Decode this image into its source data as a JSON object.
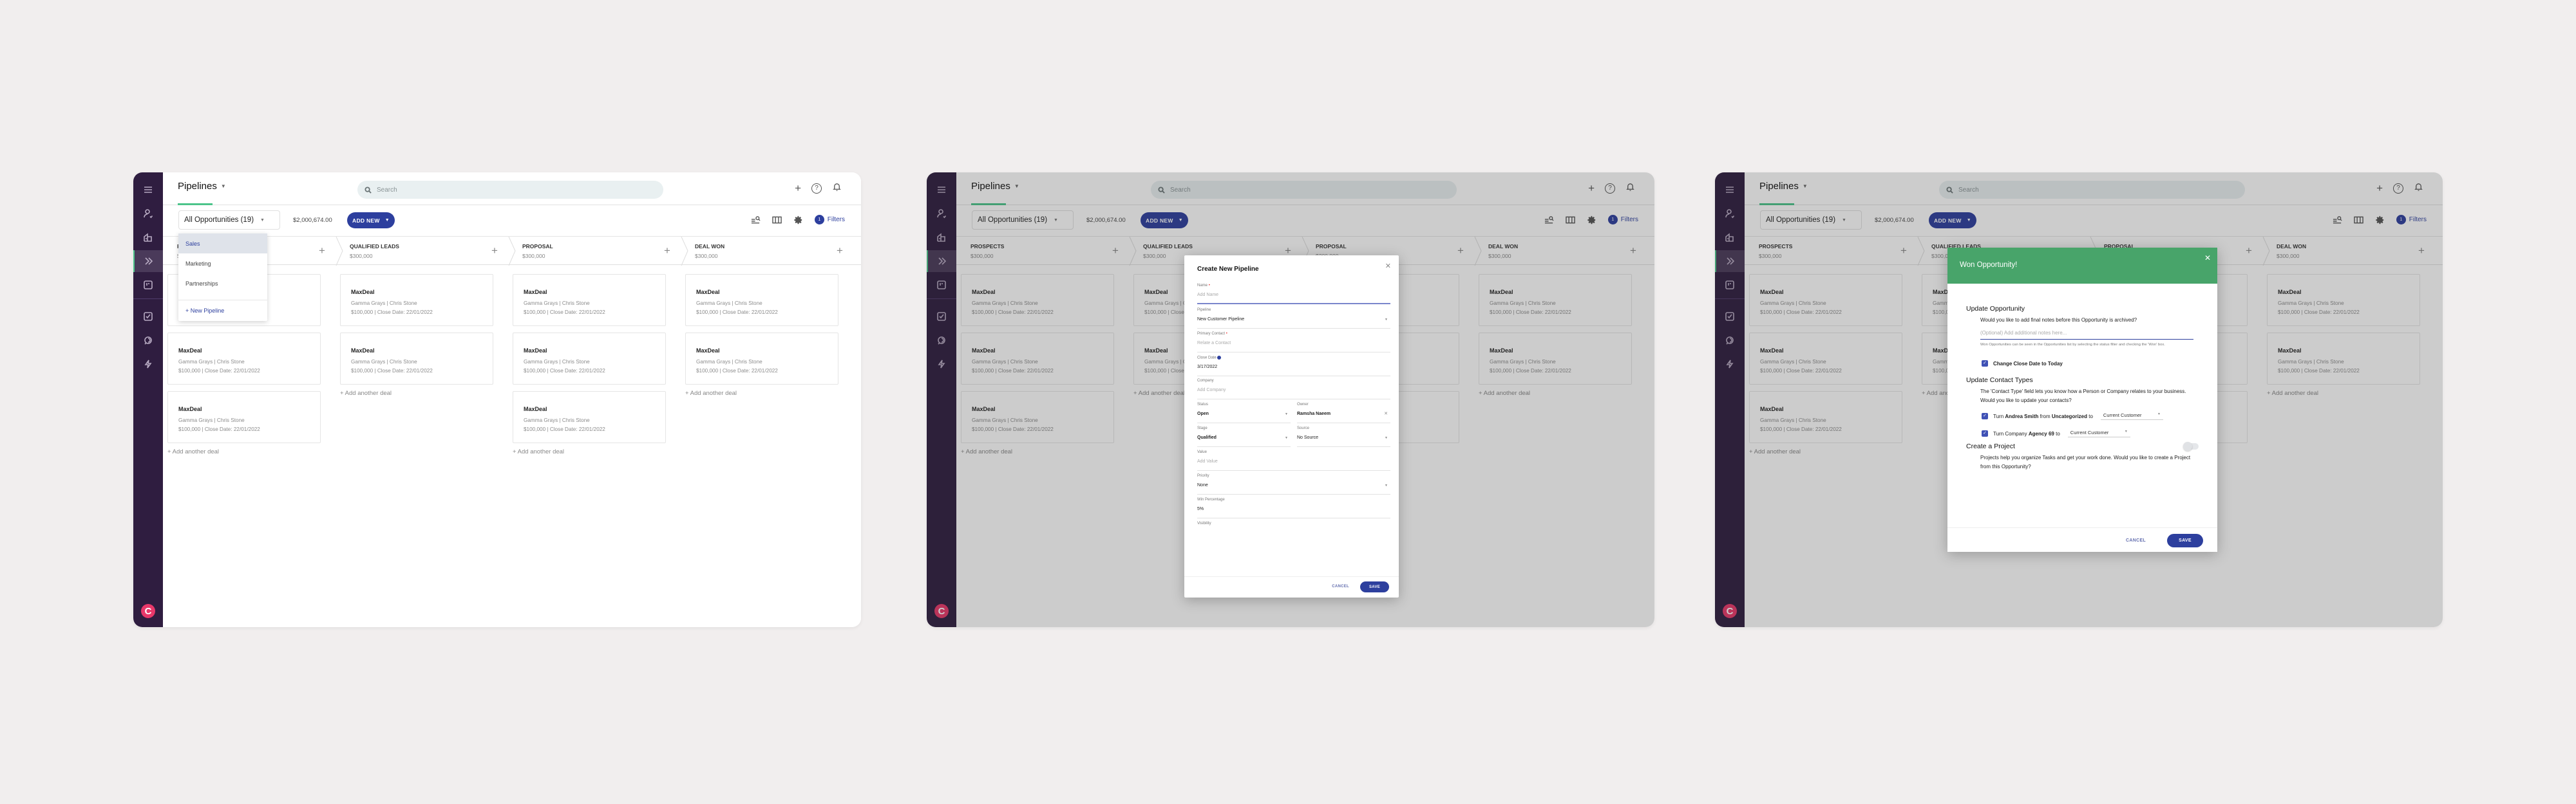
{
  "app": {
    "title": "Pipelines",
    "search_placeholder": "Search",
    "opportunity_filter": "All Opportunities (19)",
    "total_value": "$2,000,674.00",
    "add_new_label": "ADD NEW",
    "filters_label": "Filters",
    "filters_count": "1",
    "add_deal_label": "+ Add another deal",
    "stages": [
      {
        "name": "PROSPECTS",
        "amount": "$300,000"
      },
      {
        "name": "QUALIFIED LEADS",
        "amount": "$300,000"
      },
      {
        "name": "PROPOSAL",
        "amount": "$300,000"
      },
      {
        "name": "DEAL WON",
        "amount": "$300,000"
      }
    ],
    "deal": {
      "name": "MaxDeal",
      "company_contact": "Gamma Grays | Chris Stone",
      "value_date": "$100,000 | Close Date: 22/01/2022"
    },
    "cards_per_stage": [
      3,
      2,
      3,
      2
    ]
  },
  "pipeline_dropdown": {
    "items": [
      "Sales",
      "Marketing",
      "Partnerships"
    ],
    "selected": "Sales",
    "new_pipeline_label": "+ New Pipeline"
  },
  "create_pipeline_modal": {
    "title": "Create New Pipeline",
    "fields": {
      "name_label": "Name",
      "name_placeholder": "Add Name",
      "pipeline_label": "Pipeline",
      "pipeline_value": "New Customer Pipeline",
      "primary_contact_label": "Primary Contact",
      "primary_contact_placeholder": "Relate a Contact",
      "close_date_label": "Close Date",
      "close_date_value": "3/17/2022",
      "company_label": "Company",
      "company_placeholder": "Add Company",
      "status_label": "Status",
      "status_value": "Open",
      "owner_label": "Owner",
      "owner_value": "Ramsha Naeem",
      "stage_label": "Stage",
      "stage_value": "Qualified",
      "source_label": "Source",
      "source_value": "No Source",
      "value_label": "Value",
      "value_placeholder": "Add Value",
      "priority_label": "Priority",
      "priority_value": "None",
      "win_percentage_label": "Win Percentage",
      "win_percentage_value": "5%",
      "visibility_label": "Visibility"
    },
    "cancel_label": "CANCEL",
    "save_label": "SAVE"
  },
  "won_modal": {
    "title": "Won Opportunity!",
    "update_opportunity_title": "Update Opportunity",
    "update_opportunity_question": "Would you like to add final notes before this Opportunity is archived?",
    "notes_placeholder": "(Optional) Add additional notes here...",
    "notes_hint": "Won Opportunities can be seen in the Opportunities list by selecting the status filter and checking the 'Won' box.",
    "change_close_date_label": "Change Close Date to Today",
    "change_close_date_checked": true,
    "update_contact_types_title": "Update Contact Types",
    "update_contact_types_text": "The 'Contact Type' field lets you know how a Person or Company relates to your business. Would you like to update your contacts?",
    "person_row": {
      "prefix": "Turn",
      "name": "Andrea Smith",
      "from_word": "from",
      "from_type": "Uncategorized",
      "to_word": "to",
      "to_type": "Current Customer",
      "checked": true
    },
    "company_row": {
      "prefix": "Turn Company",
      "name": "Agency 69",
      "to_word": "to",
      "to_type": "Current Customer",
      "checked": true
    },
    "create_project_title": "Create a Project",
    "create_project_text": "Projects help you organize Tasks and get your work done. Would you like to create a Project from this Opportunity?",
    "create_project_enabled": false,
    "cancel_label": "CANCEL",
    "save_label": "SAVE"
  }
}
